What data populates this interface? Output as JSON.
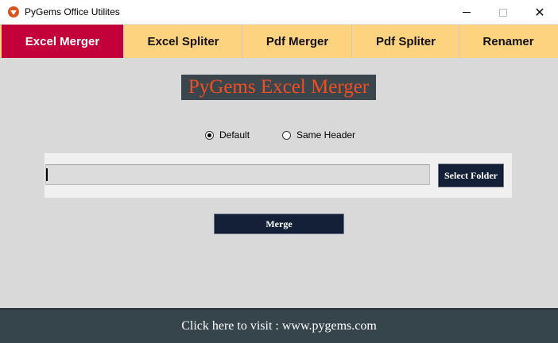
{
  "window": {
    "title": "PyGems Office Utilites",
    "minimize_icon": "minimize-icon",
    "maximize_icon": "maximize-icon",
    "close_icon": "close-icon",
    "close_glyph": "✕"
  },
  "tabs": [
    {
      "label": "Excel Merger",
      "active": true
    },
    {
      "label": "Excel Spliter",
      "active": false
    },
    {
      "label": "Pdf Merger",
      "active": false
    },
    {
      "label": "Pdf Spliter",
      "active": false
    },
    {
      "label": "Renamer",
      "active": false
    }
  ],
  "main": {
    "heading": "PyGems Excel Merger",
    "radio_options": [
      {
        "label": "Default",
        "checked": true
      },
      {
        "label": "Same Header",
        "checked": false
      }
    ],
    "folder_input": {
      "value": "",
      "placeholder": ""
    },
    "select_folder_label": "Select Folder",
    "merge_label": "Merge"
  },
  "footer": {
    "link_text": "Click here to visit : www.pygems.com"
  },
  "colors": {
    "active_tab": "#c4003a",
    "tab_bar": "#fdd37f",
    "heading_text": "#f04e23",
    "heading_bg": "#3b464c",
    "button_bg": "#132038",
    "footer_bg": "#36454c",
    "content_bg": "#d9d9d9"
  }
}
